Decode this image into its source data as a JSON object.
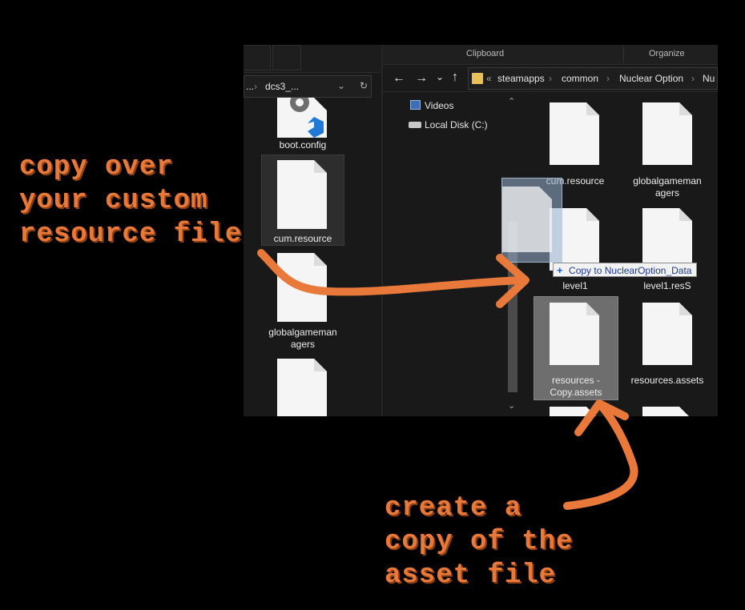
{
  "left_pane": {
    "address": "dcs3_...",
    "address_prefix": "...",
    "files": [
      {
        "label": "boot.config"
      },
      {
        "label": "cum.resource"
      },
      {
        "label": "globalgameman\nagers"
      },
      {
        "label": ""
      }
    ]
  },
  "ribbon": {
    "clipboard": "Clipboard",
    "organize": "Organize"
  },
  "breadcrumb": {
    "overflow": "«",
    "items": [
      "steamapps",
      "common",
      "Nuclear Option",
      "Nu"
    ]
  },
  "nav_pane": {
    "items": [
      {
        "label": "Videos",
        "icon": "videos-icon"
      },
      {
        "label": "Local Disk (C:)",
        "icon": "drive-icon"
      }
    ]
  },
  "content": {
    "files": [
      {
        "label": "cum.resource"
      },
      {
        "label": "globalgameman\nagers"
      },
      {
        "label": "level1"
      },
      {
        "label": "level1.resS"
      },
      {
        "label": "resources -\nCopy.assets"
      },
      {
        "label": "resources.assets"
      }
    ],
    "drag_tooltip": "Copy to NuclearOption_Data",
    "drag_tooltip_symbol": "+"
  },
  "annotations": {
    "top_left": "copy over\nyour custom\nresource file",
    "bottom": "create a\ncopy of the\nasset file",
    "color": "#e8793a"
  }
}
